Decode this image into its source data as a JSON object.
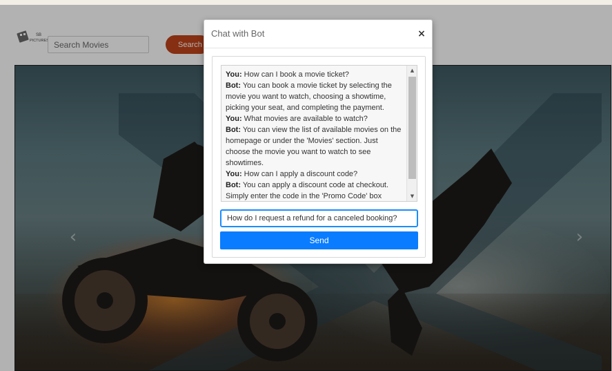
{
  "header": {
    "logo_text": "SB PICTURES",
    "search": {
      "placeholder": "Search Movies",
      "value": ""
    },
    "search_button_label": "Search"
  },
  "carousel": {
    "prev_icon": "chevron-left-icon",
    "next_icon": "chevron-right-icon"
  },
  "modal": {
    "title": "Chat with Bot",
    "close_label": "×",
    "messages": [
      {
        "sender": "You:",
        "text": " How can I book a movie ticket?"
      },
      {
        "sender": "Bot:",
        "text": " You can book a movie ticket by selecting the movie you want to watch, choosing a showtime, picking your seat, and completing the payment."
      },
      {
        "sender": "You:",
        "text": " What movies are available to watch?"
      },
      {
        "sender": "Bot:",
        "text": " You can view the list of available movies on the homepage or under the 'Movies' section. Just choose the movie you want to watch to see showtimes."
      },
      {
        "sender": "You:",
        "text": " How can I apply a discount code?"
      },
      {
        "sender": "Bot:",
        "text": " You can apply a discount code at checkout. Simply enter the code in the 'Promo Code' box"
      }
    ],
    "input_value": "How do I request a refund for a canceled booking?",
    "send_label": "Send"
  },
  "colors": {
    "search_button": "#c0441b",
    "send_button": "#0a7cff",
    "input_focus": "#1a8cff"
  }
}
